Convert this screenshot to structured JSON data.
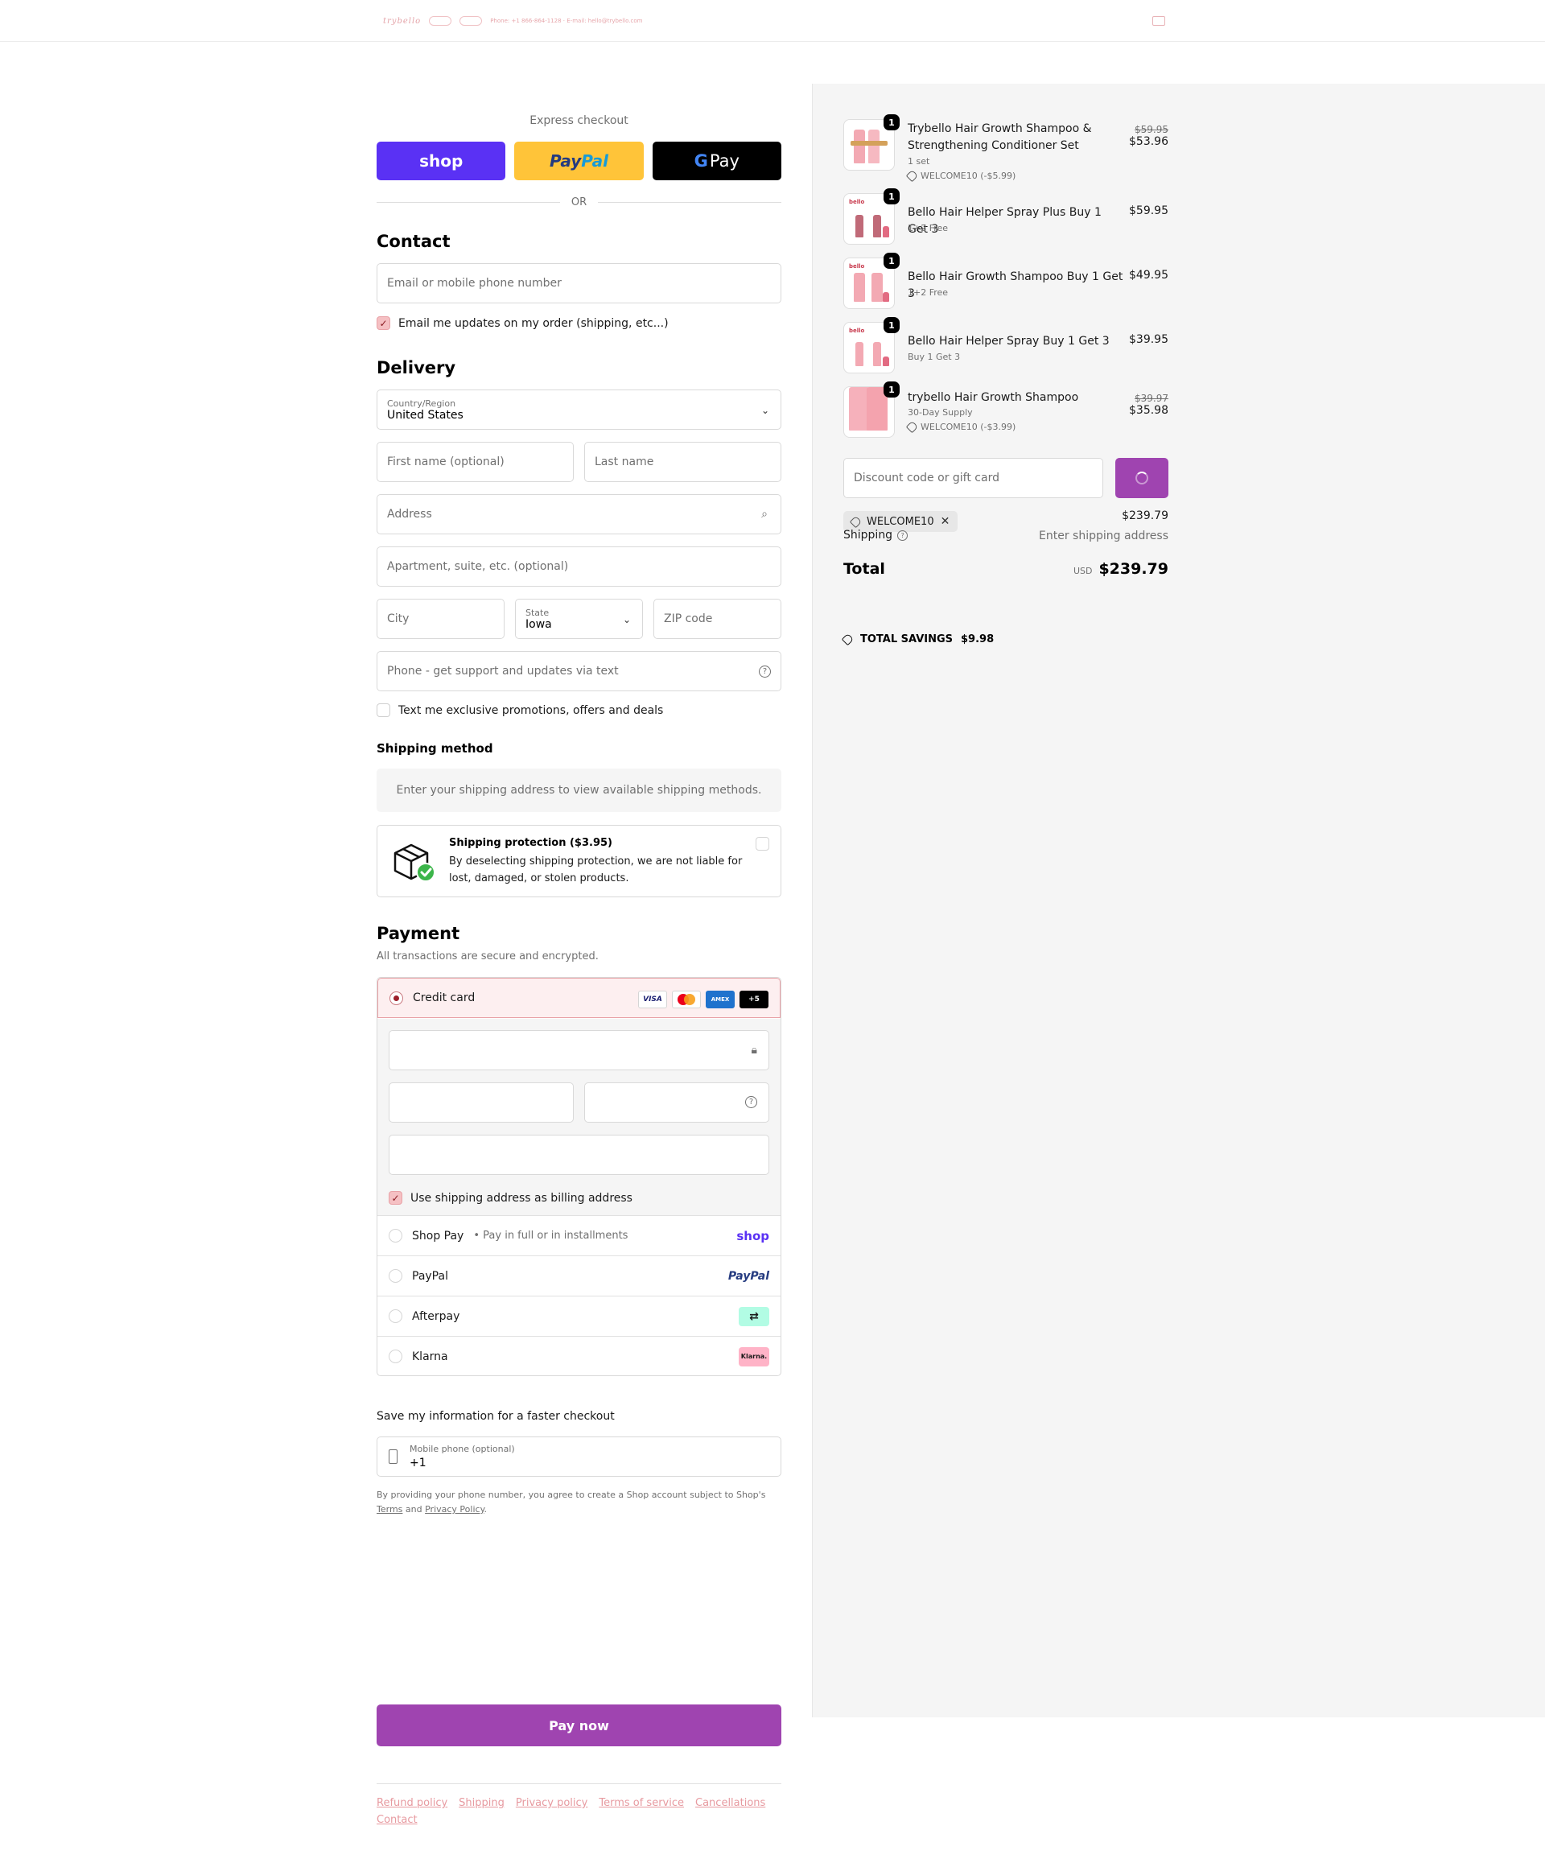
{
  "colors": {
    "accent": "#9f44b0",
    "brand_pink": "#e79aa0",
    "shop_pay": "#5a31f4",
    "paypal": "#ffc439",
    "gpay": "#000000",
    "summary_bg": "#f5f5f5"
  },
  "header": {
    "logo": "trybello",
    "logo_contact": "Phone: +1 866-864-1128 · E-mail: hello@trybello.com",
    "cart_icon": "bag-icon"
  },
  "express": {
    "label": "Express checkout",
    "shop_label": "shop",
    "paypal_label_a": "Pay",
    "paypal_label_b": "Pal",
    "gpay_g": "G",
    "gpay_label": "Pay",
    "or_label": "OR"
  },
  "contact": {
    "heading": "Contact",
    "email_placeholder": "Email or mobile phone number",
    "email_updates_label": "Email me updates on my order (shipping, etc...)",
    "email_updates_checked": true
  },
  "delivery": {
    "heading": "Delivery",
    "country_label": "Country/Region",
    "country_value": "United States",
    "first_name_placeholder": "First name (optional)",
    "last_name_placeholder": "Last name",
    "address_placeholder": "Address",
    "apartment_placeholder": "Apartment, suite, etc. (optional)",
    "city_placeholder": "City",
    "state_label": "State",
    "state_value": "Iowa",
    "zip_placeholder": "ZIP code",
    "phone_placeholder": "Phone - get support and updates via text",
    "text_promos_label": "Text me exclusive promotions, offers and deals",
    "text_promos_checked": false
  },
  "shipping_method": {
    "heading": "Shipping method",
    "notice": "Enter your shipping address to view available shipping methods."
  },
  "protection": {
    "title": "Shipping protection ($3.95)",
    "text": "By deselecting shipping protection, we are not liable for lost, damaged, or stolen products.",
    "checked": false
  },
  "payment": {
    "heading": "Payment",
    "subtitle": "All transactions are secure and encrypted.",
    "credit_card_label": "Credit card",
    "card_brands": [
      "VISA",
      "mastercard",
      "AMEX",
      "+5"
    ],
    "billing_same_label": "Use shipping address as billing address",
    "billing_same_checked": true,
    "options": [
      {
        "label": "Shop Pay",
        "sub": "Pay in full or in installments",
        "logo": "shop"
      },
      {
        "label": "PayPal",
        "sub": "",
        "logo": "PayPal"
      },
      {
        "label": "Afterpay",
        "sub": "",
        "logo": "afterpay-icon"
      },
      {
        "label": "Klarna",
        "sub": "",
        "logo": "Klarna."
      }
    ]
  },
  "remember": {
    "label": "Save my information for a faster checkout",
    "phone_label": "Mobile phone (optional)",
    "phone_value": "+1",
    "legal_prefix": "By providing your phone number, you agree to create a Shop account subject to Shop's",
    "terms": "Terms",
    "and": "and",
    "privacy": "Privacy Policy",
    "period": "."
  },
  "pay_now_label": "Pay now",
  "footer": {
    "links": [
      "Refund policy",
      "Shipping",
      "Privacy policy",
      "Terms of service",
      "Cancellations",
      "Contact"
    ]
  },
  "summary": {
    "items": [
      {
        "qty": "1",
        "name": "Trybello Hair Growth Shampoo & Strengthening Conditioner Set",
        "variant": "1 set",
        "discount": "WELCOME10 (-$5.99)",
        "old_price": "$59.95",
        "price": "$53.96"
      },
      {
        "qty": "1",
        "name": "Bello Hair Helper Spray Plus Buy 1 Get 3",
        "variant": "1+2 Free",
        "discount": "",
        "old_price": "",
        "price": "$59.95"
      },
      {
        "qty": "1",
        "name": "Bello Hair Growth Shampoo Buy 1 Get 3",
        "variant": "1+2 Free",
        "discount": "",
        "old_price": "",
        "price": "$49.95"
      },
      {
        "qty": "1",
        "name": "Bello Hair Helper Spray Buy 1 Get 3",
        "variant": "Buy 1 Get 3",
        "discount": "",
        "old_price": "",
        "price": "$39.95"
      },
      {
        "qty": "1",
        "name": "trybello Hair Growth Shampoo",
        "variant": "30-Day Supply",
        "discount": "WELCOME10 (-$3.99)",
        "old_price": "$39.97",
        "price": "$35.98"
      }
    ],
    "discount_placeholder": "Discount code or gift card",
    "applied_code": "WELCOME10",
    "subtotal_value": "$239.79",
    "shipping_label": "Shipping",
    "shipping_value": "Enter shipping address",
    "total_label": "Total",
    "total_currency": "USD",
    "total_value": "$239.79",
    "savings_label": "TOTAL SAVINGS",
    "savings_value": "$9.98"
  }
}
